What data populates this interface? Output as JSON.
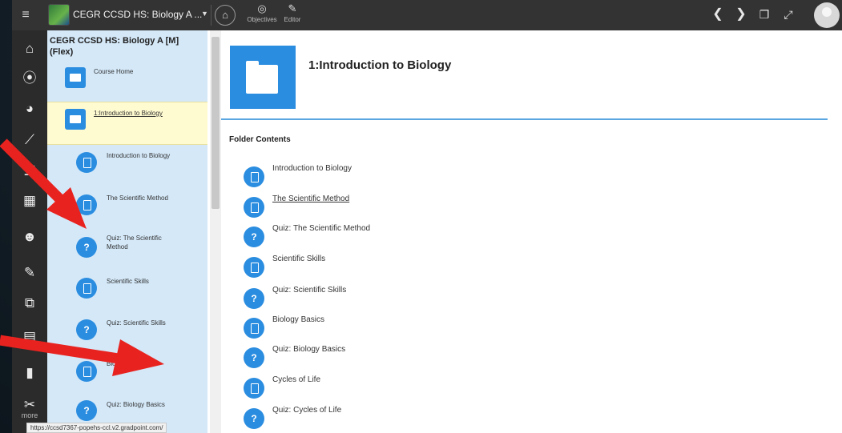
{
  "topbar": {
    "course_title": "CEGR CCSD HS: Biology A ...",
    "tools": [
      {
        "label": "Objectives",
        "icon": "target-icon"
      },
      {
        "label": "Editor",
        "icon": "pencil-icon"
      }
    ]
  },
  "rail": {
    "icons": [
      "home-icon",
      "play-icon",
      "dashboard-icon",
      "chart-icon",
      "list-icon",
      "calendar-icon",
      "people-icon",
      "edit-icon",
      "external-link-icon",
      "book-icon",
      "bar-chart-icon",
      "tools-icon"
    ],
    "more_label": "more"
  },
  "tree": {
    "title": "CEGR CCSD HS: Biology A [M] (Flex)",
    "items": [
      {
        "label": "Course Home",
        "kind": "folder"
      },
      {
        "label": "1:Introduction to Biology",
        "kind": "folder",
        "selected": true
      },
      {
        "label": "Introduction to Biology",
        "kind": "doc"
      },
      {
        "label": "The Scientific Method",
        "kind": "doc"
      },
      {
        "label": "Quiz: The Scientific Method",
        "kind": "quiz"
      },
      {
        "label": "Scientific Skills",
        "kind": "doc"
      },
      {
        "label": "Quiz: Scientific Skills",
        "kind": "quiz"
      },
      {
        "label": "Biology",
        "kind": "doc"
      },
      {
        "label": "Quiz: Biology Basics",
        "kind": "quiz"
      }
    ]
  },
  "main": {
    "title": "1:Introduction to Biology",
    "folder_contents_label": "Folder Contents",
    "items": [
      {
        "label": "Introduction to Biology",
        "kind": "doc"
      },
      {
        "label": "The Scientific Method",
        "kind": "doc"
      },
      {
        "label": "Quiz: The Scientific Method",
        "kind": "quiz"
      },
      {
        "label": "Scientific Skills",
        "kind": "doc"
      },
      {
        "label": "Quiz: Scientific Skills",
        "kind": "quiz"
      },
      {
        "label": "Biology Basics",
        "kind": "doc"
      },
      {
        "label": "Quiz: Biology Basics",
        "kind": "quiz"
      },
      {
        "label": "Cycles of Life",
        "kind": "doc"
      },
      {
        "label": "Quiz: Cycles of Life",
        "kind": "quiz"
      }
    ]
  },
  "status_url": "https://ccsd7367-popehs-ccl.v2.gradpoint.com/",
  "colors": {
    "accent": "#2b8de0",
    "selected_bg": "#fffbd0",
    "arrow": "#e8231f"
  }
}
